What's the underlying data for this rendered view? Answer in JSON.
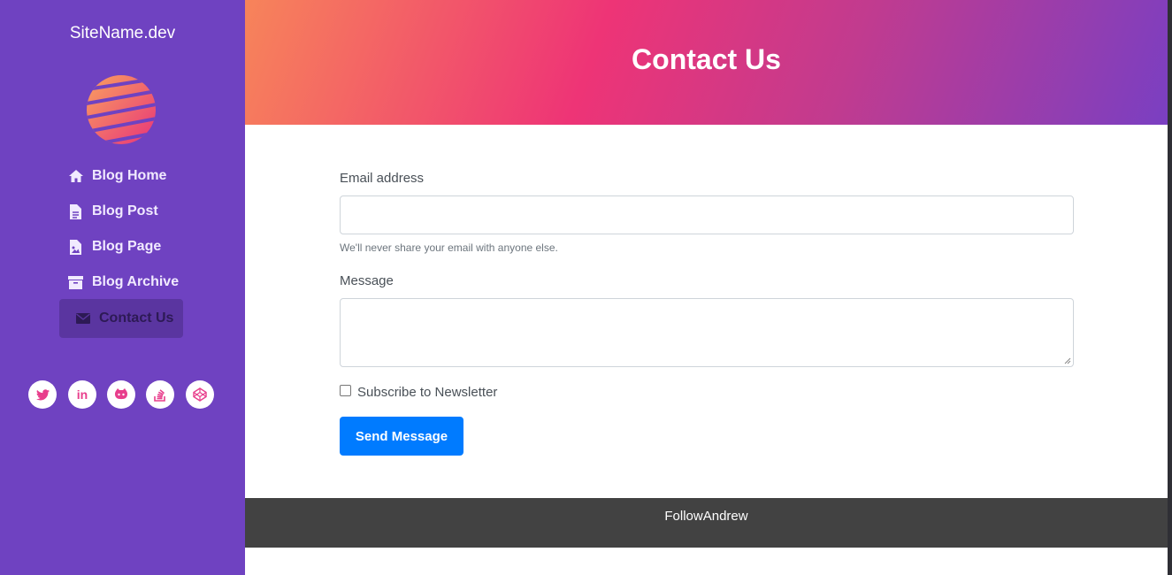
{
  "site": {
    "name": "SiteName.dev"
  },
  "nav": [
    {
      "label": "Blog Home",
      "icon": "home-icon"
    },
    {
      "label": "Blog Post",
      "icon": "file-text-icon"
    },
    {
      "label": "Blog Page",
      "icon": "file-image-icon"
    },
    {
      "label": "Blog Archive",
      "icon": "archive-icon"
    },
    {
      "label": "Contact Us",
      "icon": "envelope-icon",
      "active": true
    }
  ],
  "social": [
    {
      "icon": "twitter-icon"
    },
    {
      "icon": "linkedin-icon",
      "glyph": "in"
    },
    {
      "icon": "github-icon"
    },
    {
      "icon": "stackoverflow-icon"
    },
    {
      "icon": "codepen-icon"
    }
  ],
  "header": {
    "title": "Contact Us"
  },
  "form": {
    "email_label": "Email address",
    "email_value": "",
    "email_help": "We'll never share your email with anyone else.",
    "message_label": "Message",
    "message_value": "",
    "subscribe_label": "Subscribe to Newsletter",
    "subscribe_checked": false,
    "submit_label": "Send Message"
  },
  "footer": {
    "text": "FollowAndrew"
  },
  "colors": {
    "sidebar": "#6f42c1",
    "sidebar_active": "#5a35a0",
    "accent_pink": "#e83e8c",
    "button": "#007bff",
    "footer": "#424242"
  }
}
